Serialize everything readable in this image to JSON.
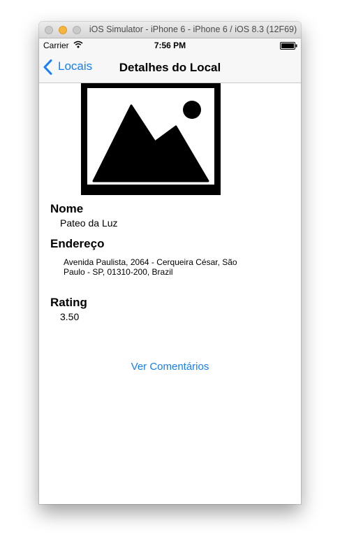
{
  "window": {
    "title": "iOS Simulator - iPhone 6 - iPhone 6 / iOS 8.3 (12F69)"
  },
  "status_bar": {
    "carrier": "Carrier",
    "time": "7:56 PM"
  },
  "nav": {
    "back_label": "Locais",
    "title": "Detalhes do Local"
  },
  "details": {
    "name_label": "Nome",
    "name_value": "Pateo da Luz",
    "address_label": "Endereço",
    "address_value": "Avenida Paulista, 2064 - Cerqueira César, São Paulo - SP, 01310-200, Brazil",
    "rating_label": "Rating",
    "rating_value": "3.50"
  },
  "actions": {
    "comments_label": "Ver Comentários"
  },
  "icons": {
    "placeholder_image": "image-placeholder-icon",
    "back": "chevron-left-icon",
    "wifi": "wifi-icon",
    "battery": "battery-icon"
  },
  "colors": {
    "tint": "#157efb",
    "bar_background": "#f7f7f7",
    "minimize_button": "#f6b63e"
  }
}
